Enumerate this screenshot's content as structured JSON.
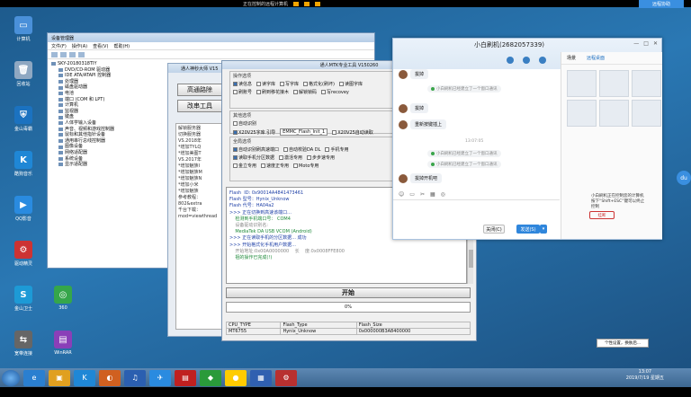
{
  "topbar": {
    "title": "正在控制的远程计算机",
    "icons": [
      "minimize-icon",
      "restore-icon",
      "close-icon"
    ]
  },
  "qq_badge": "远程协助",
  "desktop_icons": [
    {
      "label": "计算机",
      "color": "#4a90d9",
      "glyph": "▭"
    },
    {
      "label": "回收站",
      "color": "#8fa8c2",
      "glyph": "🗑"
    },
    {
      "label": "金山毒霸",
      "color": "#1b72c0",
      "glyph": "⛨"
    },
    {
      "label": "酷狗音乐",
      "color": "#1f87d6",
      "glyph": "K"
    },
    {
      "label": "QQ影音",
      "color": "#2a8be0",
      "glyph": "▶"
    },
    {
      "label": "驱动精灵",
      "color": "#c33",
      "glyph": "⚙"
    },
    {
      "label": "金山卫士",
      "color": "#1d9ad6",
      "glyph": "S"
    },
    {
      "label": "360",
      "color": "#35a64a",
      "glyph": "◎"
    },
    {
      "label": "宽带连接",
      "color": "#666",
      "glyph": "⇆"
    },
    {
      "label": "WinRAR",
      "color": "#8a3fb8",
      "glyph": "▤"
    }
  ],
  "devmgr": {
    "title": "设备管理器",
    "menus": [
      "文件(F)",
      "操作(A)",
      "查看(V)",
      "帮助(H)"
    ],
    "root": "SKY-20180318TIY",
    "items": [
      "DVD/CD-ROM 驱动器",
      "IDE ATA/ATAPI 控制器",
      "处理器",
      "磁盘驱动器",
      "电池",
      "端口 (COM 和 LPT)",
      "计算机",
      "监视器",
      "键盘",
      "人体学输入设备",
      "声音、视频和游戏控制器",
      "鼠标和其他指针设备",
      "通用串行总线控制器",
      "图像设备",
      "网络适配器",
      "系统设备",
      "显示适配器"
    ]
  },
  "flashtool": {
    "title": "通人神秒大师 V15",
    "btn_high": "高通路除",
    "btn_mode": "改串工具",
    "log": [
      "解锁服务器",
      "切换服务器",
      "",
      "VS.2018年",
      "*增加TYLQ",
      "*增加美图T",
      "VS.2017年",
      "*增加魅族I",
      "*增加魅族M",
      "*增加魅族N",
      "*增加小米",
      "*增加魅族",
      "参考教程：",
      "802&extra",
      "千台下载：",
      "mod=viewthread"
    ]
  },
  "mtk": {
    "title": "通人MTK专业工具 V150260",
    "op_label": "操作选项",
    "ops_row1": [
      "读信息",
      "读字库",
      "写字库",
      "格式化(刷坏)",
      "读图字库"
    ],
    "ops_row2": [
      "刷账号",
      "刷到移花接木",
      "解锁锁码",
      "写recovey"
    ],
    "other_label": "其他选项",
    "auth_label": "自动识别",
    "chip_label": "X20V25字库 引导",
    "chip_value": "EMMC_Flash_Init_1",
    "x20_label": "X20V25自动读取",
    "all_label": "全局选项",
    "all_row1": [
      "自动识别刷高速端口",
      "自动校验DA DL",
      "手机专用"
    ],
    "all_row2": [
      "读取手机分区数据",
      "激活专用",
      "步步速专用"
    ],
    "all_row3": [
      "金立专用",
      "速度正专用",
      "Moto专用"
    ],
    "log": [
      {
        "t": "Flash  ID: 0x90014A4841473461",
        "c": "blue"
      },
      {
        "t": "Flash 型号：Hynix_Unknow",
        "c": "blue"
      },
      {
        "t": "Flash 代号：HA04a2",
        "c": "blue"
      },
      {
        "t": ">>> 正在切换到高速该端口...",
        "c": "blue"
      },
      {
        "t": "    检测到手机端口号： COM4",
        "c": "green"
      },
      {
        "t": "    设备驱动识别名:",
        "c": "grey"
      },
      {
        "t": "    MediaTek DA USB VCOM (Android)",
        "c": "green"
      },
      {
        "t": ">>> 正在读取手机的分区数据... 成功",
        "c": "blue"
      },
      {
        "t": ">>> 开始格式化手机用户数据...",
        "c": "blue"
      },
      {
        "t": "    开始地址:0x00A0000000    长    度:0x0008FFE800",
        "c": "grey"
      },
      {
        "t": "    祖的操作已完成(!)",
        "c": "green"
      }
    ],
    "start_label": "开始",
    "progress": 0,
    "progress_text": "0%",
    "table": {
      "headers": [
        "CPU_TYPE",
        "Flash_Type",
        "Flash_Size"
      ],
      "row": [
        "MT6755",
        "Hynix_Unknow",
        "0x000000B3A8400000"
      ]
    }
  },
  "chat": {
    "title": "小白刷机(2682057339)",
    "controls": [
      "—",
      "□",
      "✕"
    ],
    "messages": [
      {
        "text": "拔掉"
      },
      {
        "sys": "小白刷机已经建立了一个窗口通讯"
      },
      {
        "text": "拔掉"
      },
      {
        "text": "重新按键插上"
      },
      {
        "time": "13:07:05"
      },
      {
        "sys": "小白刷机已经建立了一个窗口通讯"
      },
      {
        "sys": "小白刷机已经建立了一个窗口通讯"
      },
      {
        "text": "拔掉开机吧"
      }
    ],
    "input_tools": [
      "☺",
      "▭",
      "✂",
      "▦",
      "◎"
    ],
    "close_btn": "关闭(C)",
    "send_btn": "发送(S)",
    "tabs": [
      "场景",
      "远程桌面"
    ],
    "note": "小白刷机正在控制您的计算机\n按下“Shift+ESC”键可以终止控制",
    "hangup": "挂断"
  },
  "tray_popup": "个性设置，换肤后...",
  "taskbar": {
    "items": [
      {
        "glyph": "e",
        "color": "#2a7fd0"
      },
      {
        "glyph": "▣",
        "color": "#e0a020"
      },
      {
        "glyph": "K",
        "color": "#1f87d6"
      },
      {
        "glyph": "◐",
        "color": "#d06020"
      },
      {
        "glyph": "♫",
        "color": "#2b5fb0"
      },
      {
        "glyph": "✈",
        "color": "#2a8be0"
      },
      {
        "glyph": "▤",
        "color": "#c02020"
      },
      {
        "glyph": "◆",
        "color": "#2a9a3a"
      },
      {
        "glyph": "●",
        "color": "#ffcc00"
      },
      {
        "glyph": "▦",
        "color": "#3060b0"
      },
      {
        "glyph": "⚙",
        "color": "#b83030"
      }
    ],
    "time": "13:07",
    "date": "2019/7/19 星期五"
  },
  "side_float": "du"
}
